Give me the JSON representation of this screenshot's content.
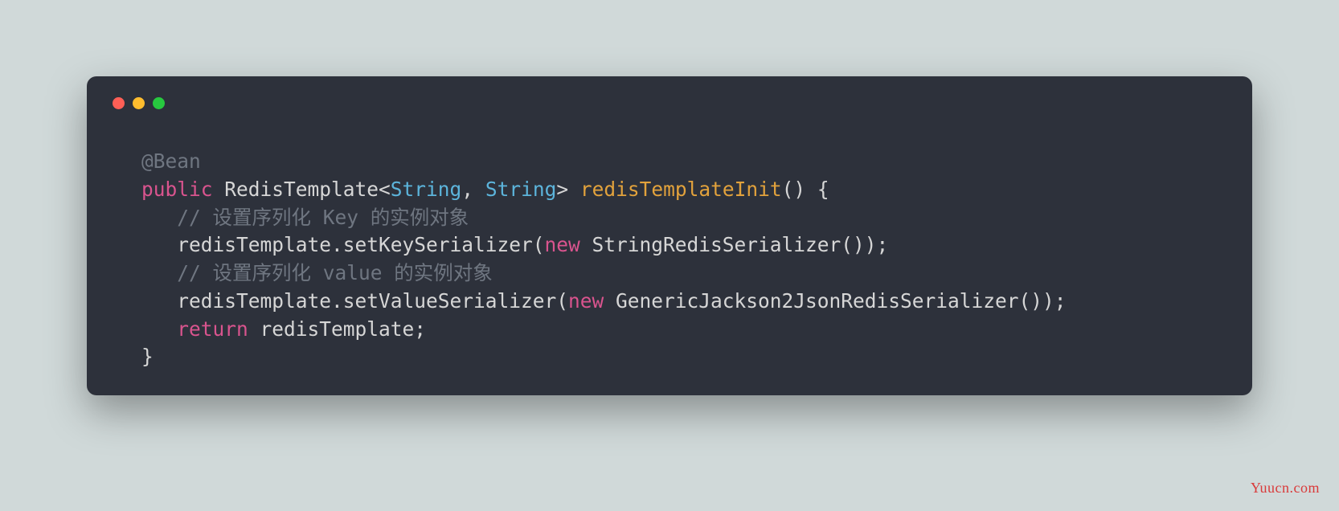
{
  "watermark": "Yuucn.com",
  "colors": {
    "background": "#d0d9d9",
    "window": "#2d313b",
    "dot_red": "#ff5f56",
    "dot_yellow": "#ffbd2e",
    "dot_green": "#27c93f",
    "annotation": "#6f7681",
    "keyword": "#d9548e",
    "type": "#5cb4db",
    "method": "#e2a23c",
    "comment": "#6f7681",
    "default": "#d6d6d6",
    "watermark": "#d93a3a"
  },
  "code_lines": [
    [
      {
        "text": "@Bean",
        "cls": "tok-annotation"
      }
    ],
    [
      {
        "text": "public",
        "cls": "tok-keyword"
      },
      {
        "text": " RedisTemplate<",
        "cls": "tok-default"
      },
      {
        "text": "String",
        "cls": "tok-type"
      },
      {
        "text": ", ",
        "cls": "tok-default"
      },
      {
        "text": "String",
        "cls": "tok-type"
      },
      {
        "text": "> ",
        "cls": "tok-default"
      },
      {
        "text": "redisTemplateInit",
        "cls": "tok-method"
      },
      {
        "text": "() {",
        "cls": "tok-default"
      }
    ],
    [
      {
        "text": "   // 设置序列化 Key 的实例对象",
        "cls": "tok-comment"
      }
    ],
    [
      {
        "text": "   redisTemplate.setKeySerializer(",
        "cls": "tok-default"
      },
      {
        "text": "new",
        "cls": "tok-keyword"
      },
      {
        "text": " StringRedisSerializer());",
        "cls": "tok-default"
      }
    ],
    [
      {
        "text": "   // 设置序列化 value 的实例对象",
        "cls": "tok-comment"
      }
    ],
    [
      {
        "text": "   redisTemplate.setValueSerializer(",
        "cls": "tok-default"
      },
      {
        "text": "new",
        "cls": "tok-keyword"
      },
      {
        "text": " GenericJackson2JsonRedisSerializer());",
        "cls": "tok-default"
      }
    ],
    [
      {
        "text": "   ",
        "cls": "tok-default"
      },
      {
        "text": "return",
        "cls": "tok-keyword"
      },
      {
        "text": " redisTemplate;",
        "cls": "tok-default"
      }
    ],
    [
      {
        "text": "}",
        "cls": "tok-default"
      }
    ]
  ]
}
